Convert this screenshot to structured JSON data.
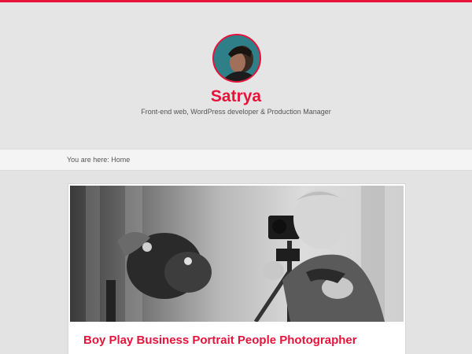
{
  "colors": {
    "accent": "#e8133a",
    "background": "#e3e3e3",
    "breadcrumb_bg": "#f4f4f4"
  },
  "site": {
    "title": "Satrya",
    "description": "Front-end web, WordPress developer & Production Manager"
  },
  "breadcrumb": {
    "text": "You are here: Home"
  },
  "post": {
    "title": "Boy Play Business Portrait People Photographer"
  }
}
